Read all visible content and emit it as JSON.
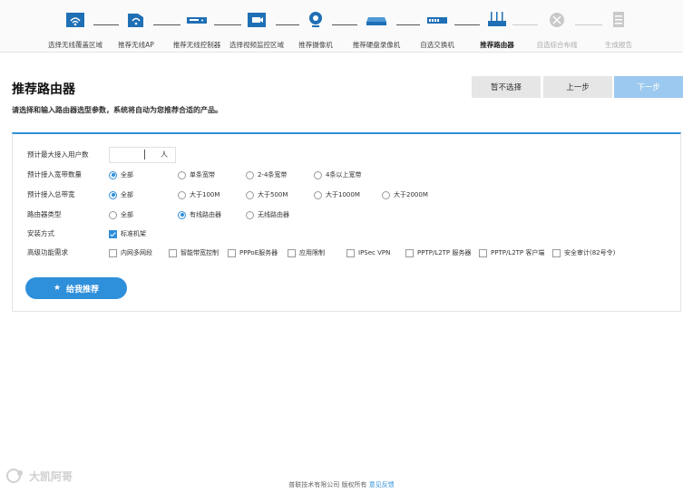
{
  "stepper": {
    "steps": [
      {
        "label": "选择无线覆盖区域",
        "icon": "wifi-area-icon",
        "state": "done"
      },
      {
        "label": "推荐无线AP",
        "icon": "wifi-ap-icon",
        "state": "done"
      },
      {
        "label": "推荐无线控制器",
        "icon": "controller-icon",
        "state": "done"
      },
      {
        "label": "选择视频监控区域",
        "icon": "camera-area-icon",
        "state": "done"
      },
      {
        "label": "推荐摄像机",
        "icon": "camera-icon",
        "state": "done"
      },
      {
        "label": "推荐硬盘录像机",
        "icon": "nvr-icon",
        "state": "done"
      },
      {
        "label": "自选交换机",
        "icon": "switch-icon",
        "state": "done"
      },
      {
        "label": "推荐路由器",
        "icon": "router-icon",
        "state": "active"
      },
      {
        "label": "自选综合布线",
        "icon": "cabling-icon",
        "state": "pending"
      },
      {
        "label": "生成报告",
        "icon": "report-icon",
        "state": "pending"
      }
    ]
  },
  "header": {
    "title": "推荐路由器",
    "subtitle": "请选择和输入路由器选型参数，系统将自动为您推荐合适的产品。",
    "skip_label": "暂不选择",
    "prev_label": "上一步",
    "next_label": "下一步"
  },
  "form": {
    "users": {
      "label": "预计最大接入用户数",
      "value": "",
      "unit": "人"
    },
    "broadband_count": {
      "label": "预计接入宽带数量",
      "options": [
        "全部",
        "单条宽带",
        "2-4条宽带",
        "4条以上宽带"
      ],
      "selected": 0
    },
    "bandwidth": {
      "label": "预计接入总带宽",
      "options": [
        "全部",
        "大于100M",
        "大于500M",
        "大于1000M",
        "大于2000M"
      ],
      "selected": 0
    },
    "router_type": {
      "label": "路由器类型",
      "options": [
        "全部",
        "有线路由器",
        "无线路由器"
      ],
      "selected": 1
    },
    "install": {
      "label": "安装方式",
      "options": [
        "标准机架"
      ],
      "checked": [
        true
      ]
    },
    "advanced": {
      "label": "高级功能需求",
      "options": [
        "内网多网段",
        "智能带宽控制",
        "PPPoE服务器",
        "应用限制",
        "IPSec VPN",
        "PPTP/L2TP 服务器",
        "PPTP/L2TP 客户端",
        "安全审计(82号令)"
      ],
      "checked": [
        false,
        false,
        false,
        false,
        false,
        false,
        false,
        false
      ]
    },
    "submit_label": "给我推荐"
  },
  "footer": {
    "copyright": "普联技术有限公司 版权所有",
    "feedback": "意见反馈"
  },
  "watermark": {
    "text": "大凯阿哥"
  },
  "colors": {
    "accent": "#2e8fda",
    "next_disabled": "#9cc9ef"
  }
}
